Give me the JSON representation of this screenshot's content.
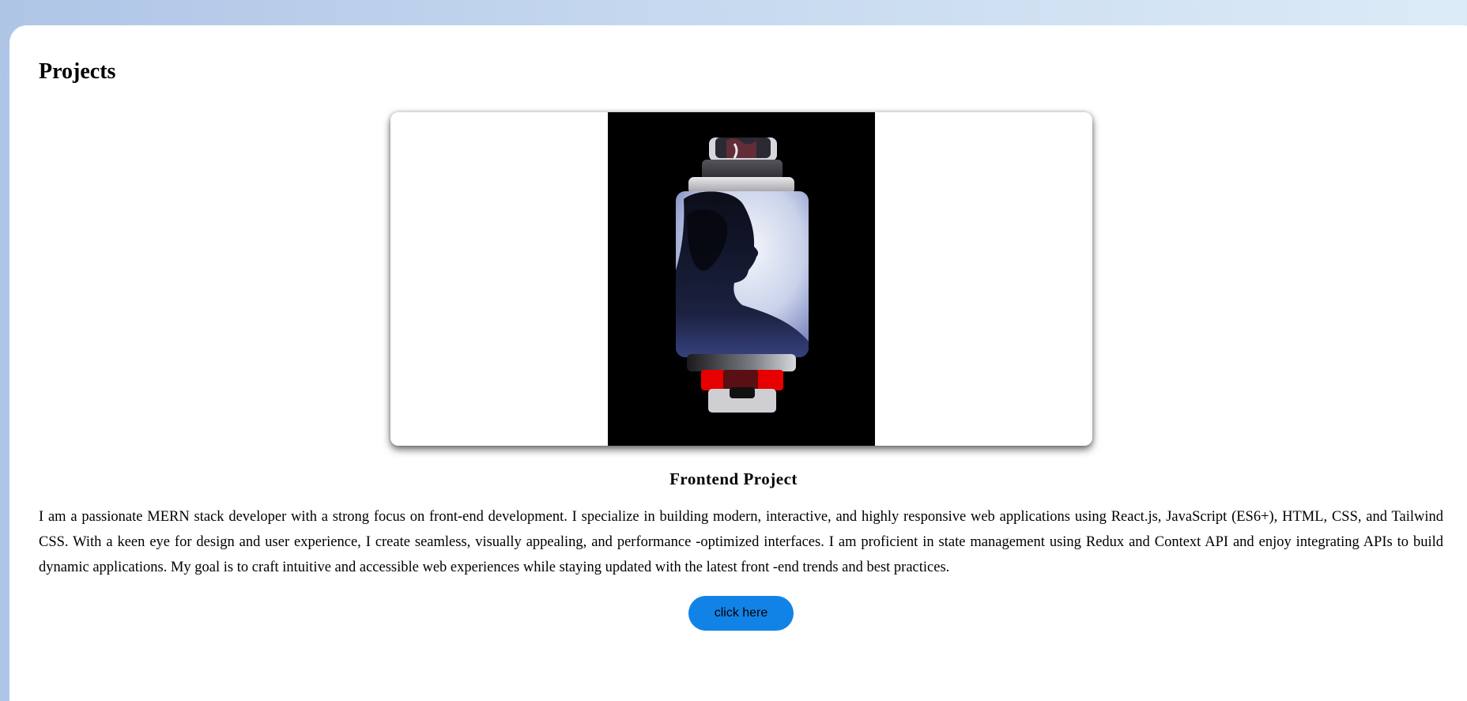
{
  "section": {
    "title": "Projects"
  },
  "project": {
    "title": "Frontend Project",
    "description": "I am a passionate MERN stack developer with a strong focus on front-end development. I specialize in building modern, interactive, and highly responsive web applications using React.js, JavaScript (ES6+), HTML, CSS, and Tailwind CSS. With a keen eye for design and user experience, I create seamless, visually appealing, and performance -optimized interfaces. I am proficient in state management using Redux and Context API and enjoy integrating APIs to build dynamic applications. My goal is to craft intuitive and accessible web experiences while staying updated with the latest front -end trends and best practices.",
    "button_label": "click here",
    "image": "abstract-stacked-portrait-artwork"
  },
  "colors": {
    "background_gradient_start": "#afc5e6",
    "background_gradient_end": "#dcebf7",
    "card": "#ffffff",
    "button": "#1283e6",
    "artwork_accent": "#e60000"
  }
}
